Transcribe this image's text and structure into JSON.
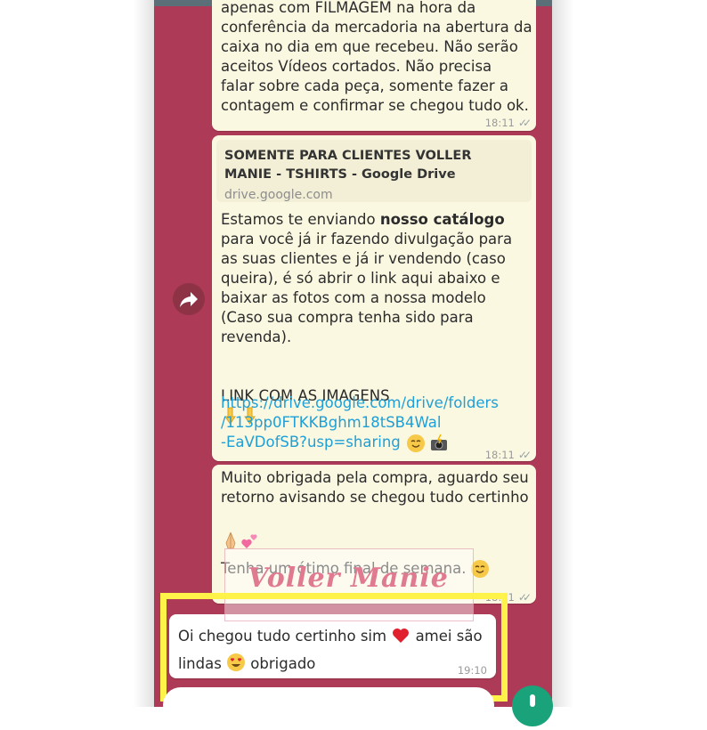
{
  "messages": {
    "m1": {
      "text": "apenas com FILMAGEM na hora da\nconferência da mercadoria na abertura da\ncaixa no dia em que recebeu. Não serão\naceitos Vídeos cortados. Não precisa\nfalar sobre cada peça, somente fazer a\ncontagem e confirmar se chegou tudo ok.",
      "time": "18:11"
    },
    "m2": {
      "preview_title": "SOMENTE PARA CLIENTES VOLLER MANIE - TSHIRTS - Google Drive",
      "preview_domain": "drive.google.com",
      "text_pre": "Estamos te enviando ",
      "text_bold": "nosso catálogo",
      "text_post": "\npara você já ir fazendo divulgação para\nas suas clientes e já ir vendendo (caso\nqueira), é só abrir o link aqui abaixo e\nbaixar as fotos com a nossa modelo\n(Caso sua compra tenha sido para\nrevenda).",
      "link_label": "LINK COM AS IMAGENS",
      "url": "https://drive.google.com/drive/folders\n/113pp0FTKKBghm18tSB4Wal\n-EaVDofSB?usp=sharing",
      "time": "18:11"
    },
    "m3": {
      "text": "Muito obrigada pela compra, aguardo seu\nretorno avisando se chegou tudo certinho",
      "text2": "Tenha um ótimo final de semana.",
      "time": "18:11"
    },
    "m4": {
      "text_a": "Oi chegou tudo certinho sim ",
      "text_b": " amei são",
      "text_c": "lindas ",
      "text_d": " obrigado",
      "time": "19:10"
    }
  },
  "watermark": "Voller Manie",
  "icons": [
    "forward-icon",
    "read-ticks-icon",
    "pointing-down-emoji",
    "hugging-face-emoji",
    "camera-flash-emoji",
    "folded-hands-emoji",
    "two-hearts-emoji",
    "red-heart-emoji",
    "heart-eyes-emoji",
    "mic-icon"
  ],
  "colors": {
    "chat_bg": "#ad3a56",
    "outgoing_bubble": "#fbf8e2",
    "incoming_bubble": "#ffffff",
    "link": "#1e9fd6",
    "highlight": "#fff34a"
  }
}
